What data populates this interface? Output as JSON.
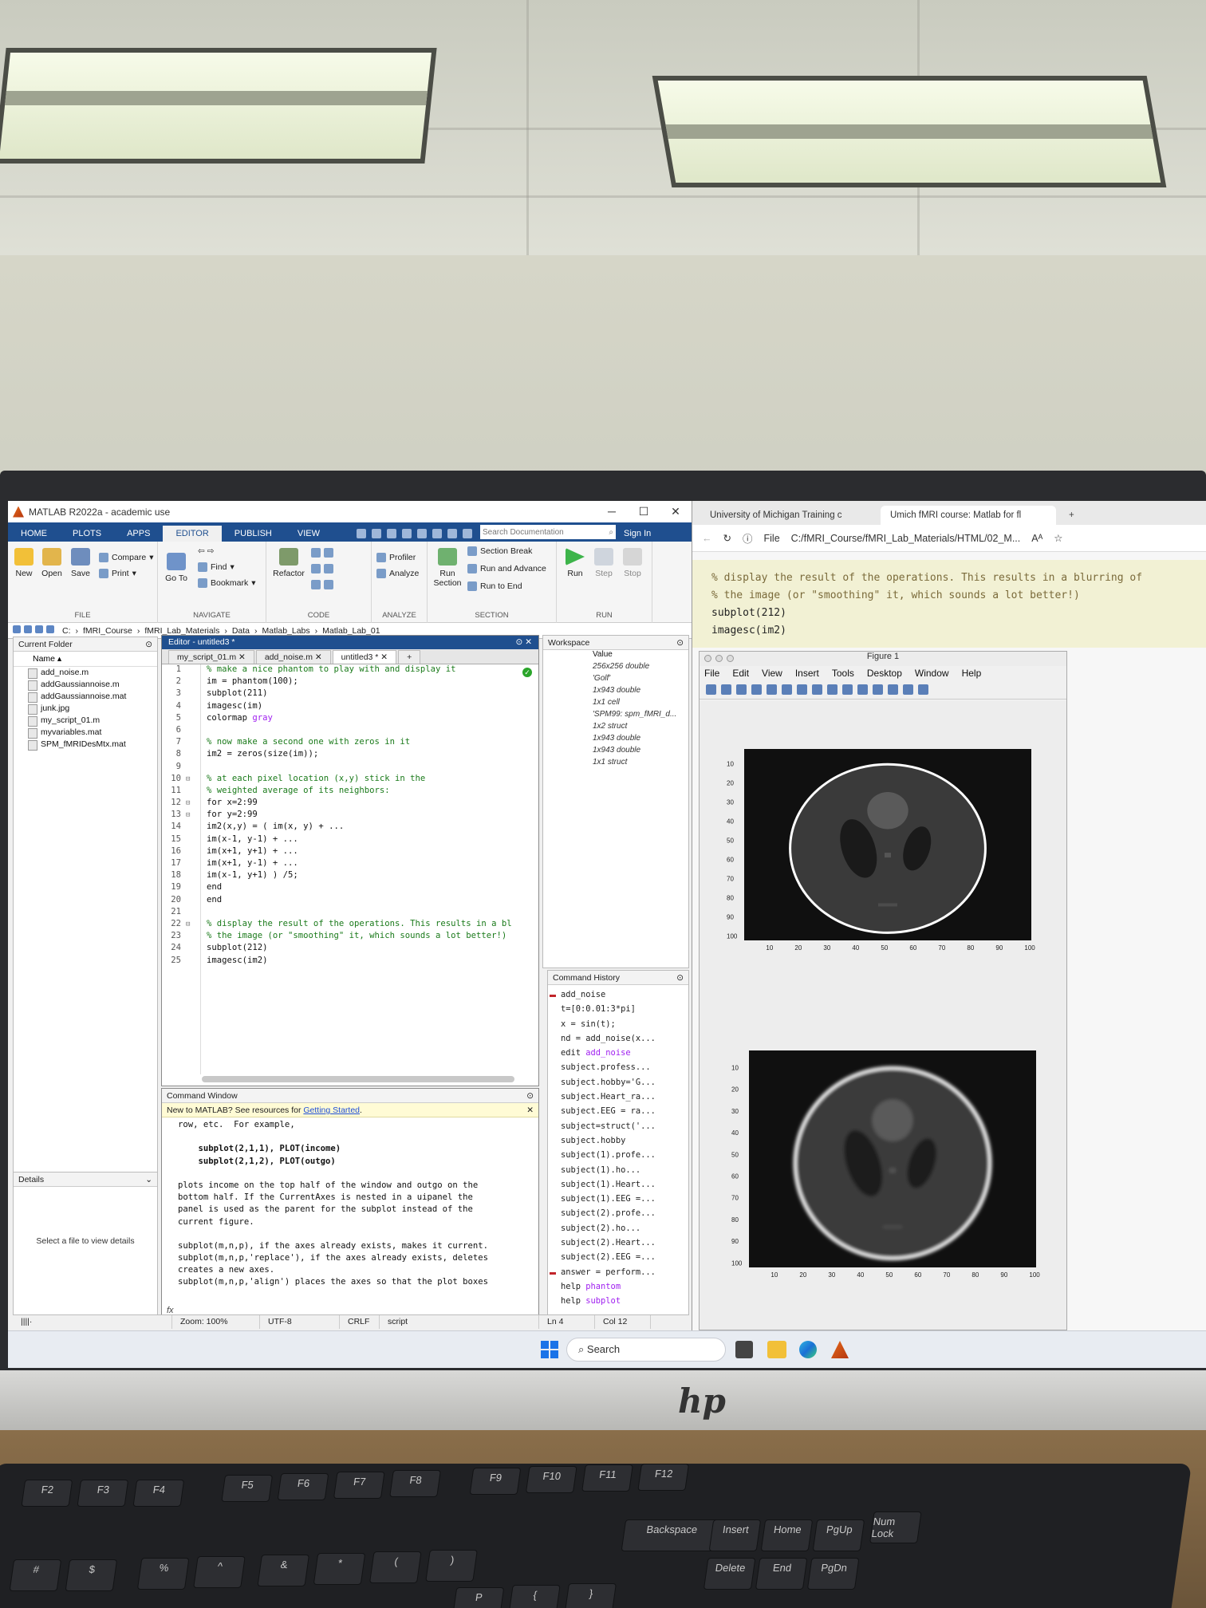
{
  "matlab": {
    "title": "MATLAB R2022a - academic use",
    "tabs": [
      "HOME",
      "PLOTS",
      "APPS",
      "EDITOR",
      "PUBLISH",
      "VIEW"
    ],
    "active_tab": "EDITOR",
    "search_placeholder": "Search Documentation",
    "sign_in": "Sign In",
    "ribbon": {
      "file": {
        "label": "FILE",
        "new": "New",
        "open": "Open",
        "save": "Save",
        "compare": "Compare",
        "print": "Print"
      },
      "navigate": {
        "label": "NAVIGATE",
        "goto": "Go To",
        "find": "Find",
        "bookmark": "Bookmark"
      },
      "code": {
        "label": "CODE",
        "refactor": "Refactor"
      },
      "analyze": {
        "label": "ANALYZE",
        "profiler": "Profiler",
        "analyze": "Analyze"
      },
      "section": {
        "label": "SECTION",
        "run_section": "Run Section",
        "section_break": "Section Break",
        "run_advance": "Run and Advance",
        "run_end": "Run to End"
      },
      "run": {
        "label": "RUN",
        "run": "Run",
        "step": "Step",
        "stop": "Stop"
      }
    },
    "path": [
      "C:",
      "fMRI_Course",
      "fMRI_Lab_Materials",
      "Data",
      "Matlab_Labs",
      "Matlab_Lab_01"
    ],
    "current_folder": {
      "title": "Current Folder",
      "header": "Name",
      "files": [
        "add_noise.m",
        "addGaussiannoise.m",
        "addGaussiannoise.mat",
        "junk.jpg",
        "my_script_01.m",
        "myvariables.mat",
        "SPM_fMRIDesMtx.mat"
      ],
      "details_title": "Details",
      "details_msg": "Select a file to view details"
    },
    "editor": {
      "title": "Editor - untitled3 *",
      "tabs": [
        "my_script_01.m",
        "add_noise.m",
        "untitled3 *"
      ],
      "lines": [
        {
          "n": "1",
          "t": "% make a nice phantom to play with and display it",
          "c": true,
          "f": false
        },
        {
          "n": "2",
          "t": "im = phantom(100);",
          "c": false,
          "f": false
        },
        {
          "n": "3",
          "t": "subplot(211)",
          "c": false,
          "f": false
        },
        {
          "n": "4",
          "t": "imagesc(im)",
          "c": false,
          "f": false
        },
        {
          "n": "5",
          "t": "colormap gray",
          "c": false,
          "f": false,
          "s": "gray"
        },
        {
          "n": "6",
          "t": "",
          "c": false,
          "f": false
        },
        {
          "n": "7",
          "t": "% now make a second one with zeros in it",
          "c": true,
          "f": false
        },
        {
          "n": "8",
          "t": "im2 = zeros(size(im));",
          "c": false,
          "f": false
        },
        {
          "n": "9",
          "t": "",
          "c": false,
          "f": false
        },
        {
          "n": "10",
          "t": "% at each pixel location (x,y) stick in the",
          "c": true,
          "f": true
        },
        {
          "n": "11",
          "t": "% weighted average of its neighbors:",
          "c": true,
          "f": false
        },
        {
          "n": "12",
          "t": "for x=2:99",
          "c": false,
          "f": true,
          "k": true
        },
        {
          "n": "13",
          "t": "for y=2:99",
          "c": false,
          "f": true,
          "k": true
        },
        {
          "n": "14",
          "t": "im2(x,y) = ( im(x, y) + ...",
          "c": false,
          "f": false
        },
        {
          "n": "15",
          "t": "im(x-1, y-1) + ...",
          "c": false,
          "f": false
        },
        {
          "n": "16",
          "t": "im(x+1, y+1) + ...",
          "c": false,
          "f": false
        },
        {
          "n": "17",
          "t": "im(x+1, y-1) + ...",
          "c": false,
          "f": false
        },
        {
          "n": "18",
          "t": "im(x-1, y+1) ) /5;",
          "c": false,
          "f": false
        },
        {
          "n": "19",
          "t": "end",
          "c": false,
          "f": false,
          "k": true
        },
        {
          "n": "20",
          "t": "end",
          "c": false,
          "f": false,
          "k": true
        },
        {
          "n": "21",
          "t": "",
          "c": false,
          "f": false
        },
        {
          "n": "22",
          "t": "% display the result of the operations. This results in a bl",
          "c": true,
          "f": true
        },
        {
          "n": "23",
          "t": "% the image (or \"smoothing\" it, which sounds a lot better!)",
          "c": true,
          "f": false
        },
        {
          "n": "24",
          "t": "subplot(212)",
          "c": false,
          "f": false
        },
        {
          "n": "25",
          "t": "imagesc(im2)",
          "c": false,
          "f": false
        }
      ]
    },
    "command_window": {
      "title": "Command Window",
      "new_prefix": "New to MATLAB? See resources for ",
      "new_link": "Getting Started",
      "new_suffix": ".",
      "lines": [
        {
          "t": "row, etc.  For example,",
          "b": false
        },
        {
          "t": "",
          "b": false
        },
        {
          "t": "    subplot(2,1,1), PLOT(income)",
          "b": true
        },
        {
          "t": "    subplot(2,1,2), PLOT(outgo)",
          "b": true
        },
        {
          "t": "",
          "b": false
        },
        {
          "t": "plots income on the top half of the window and outgo on the",
          "b": false
        },
        {
          "t": "bottom half. If the CurrentAxes is nested in a uipanel the",
          "b": false
        },
        {
          "t": "panel is used as the parent for the subplot instead of the",
          "b": false
        },
        {
          "t": "current figure.",
          "b": false
        },
        {
          "t": "",
          "b": false
        },
        {
          "t": "subplot(m,n,p), if the axes already exists, makes it current.",
          "b": false
        },
        {
          "t": "subplot(m,n,p,'replace'), if the axes already exists, deletes",
          "b": false
        },
        {
          "t": "creates a new axes.",
          "b": false
        },
        {
          "t": "subplot(m,n,p,'align') places the axes so that the plot boxes",
          "b": false
        }
      ]
    },
    "workspace": {
      "title": "Workspace",
      "value_header": "Value",
      "values": [
        "256x256 double",
        "'Golf'",
        "1x943 double",
        "1x1 cell",
        "'SPM99: spm_fMRI_d...",
        "1x2 struct",
        "1x943 double",
        "1x943 double",
        "1x1 struct"
      ]
    },
    "command_history": {
      "title": "Command History",
      "items": [
        {
          "t": "add_noise",
          "m": true
        },
        {
          "t": "t=[0:0.01:3*pi]",
          "m": false
        },
        {
          "t": "x = sin(t);",
          "m": false
        },
        {
          "t": "nd = add_noise(x...",
          "m": false
        },
        {
          "t": "edit ",
          "k": "add_noise",
          "m": false
        },
        {
          "t": "subject.profess...",
          "m": false
        },
        {
          "t": "subject.hobby='G...",
          "m": false
        },
        {
          "t": "subject.Heart_ra...",
          "m": false
        },
        {
          "t": "subject.EEG = ra...",
          "m": false
        },
        {
          "t": "subject=struct('...",
          "m": false
        },
        {
          "t": "subject.hobby",
          "m": false
        },
        {
          "t": "subject(1).profe...",
          "m": false
        },
        {
          "t": "subject(1).ho...",
          "m": false
        },
        {
          "t": "subject(1).Heart...",
          "m": false
        },
        {
          "t": "subject(1).EEG =...",
          "m": false
        },
        {
          "t": "subject(2).profe...",
          "m": false
        },
        {
          "t": "subject(2).ho...",
          "m": false
        },
        {
          "t": "subject(2).Heart...",
          "m": false
        },
        {
          "t": "subject(2).EEG =...",
          "m": false
        },
        {
          "t": "answer = perform...",
          "m": true
        },
        {
          "t": "help ",
          "k": "phantom",
          "m": false
        },
        {
          "t": "help ",
          "k": "subplot",
          "m": false
        }
      ]
    },
    "status": {
      "zoom": "Zoom: 100%",
      "encoding": "UTF-8",
      "eol": "CRLF",
      "type": "script",
      "ln": "Ln  4",
      "col": "Col  12"
    }
  },
  "browser": {
    "tabs": [
      "University of Michigan Training c",
      "Umich fMRI course: Matlab for fl"
    ],
    "file_label": "File",
    "url": "C:/fMRI_Course/fMRI_Lab_Materials/HTML/02_M...",
    "page_code": [
      {
        "t": "% display the result of the operations. This results in a blurring of",
        "c": true
      },
      {
        "t": "% the image (or \"smoothing\" it, which sounds a lot better!)",
        "c": true
      },
      {
        "t": "subplot(212)",
        "c": false
      },
      {
        "t": "imagesc(im2)",
        "c": false
      }
    ],
    "figure": {
      "title": "Figure 1",
      "menu": [
        "File",
        "Edit",
        "View",
        "Insert",
        "Tools",
        "Desktop",
        "Window",
        "Help"
      ],
      "ticks": [
        "10",
        "20",
        "30",
        "40",
        "50",
        "60",
        "70",
        "80",
        "90",
        "100"
      ]
    }
  },
  "taskbar": {
    "search": "Search"
  },
  "keyboard": {
    "keys": [
      "F2",
      "F3",
      "F4",
      "F5",
      "F6",
      "F7",
      "F8",
      "F9",
      "F10",
      "F11",
      "F12",
      "Backspace",
      "Insert",
      "Home",
      "PgUp",
      "Delete",
      "End",
      "PgDn",
      "Num Lock",
      "#",
      "$",
      "%",
      "^",
      "&",
      "*",
      "(",
      ")",
      "P",
      "{",
      "}"
    ]
  }
}
